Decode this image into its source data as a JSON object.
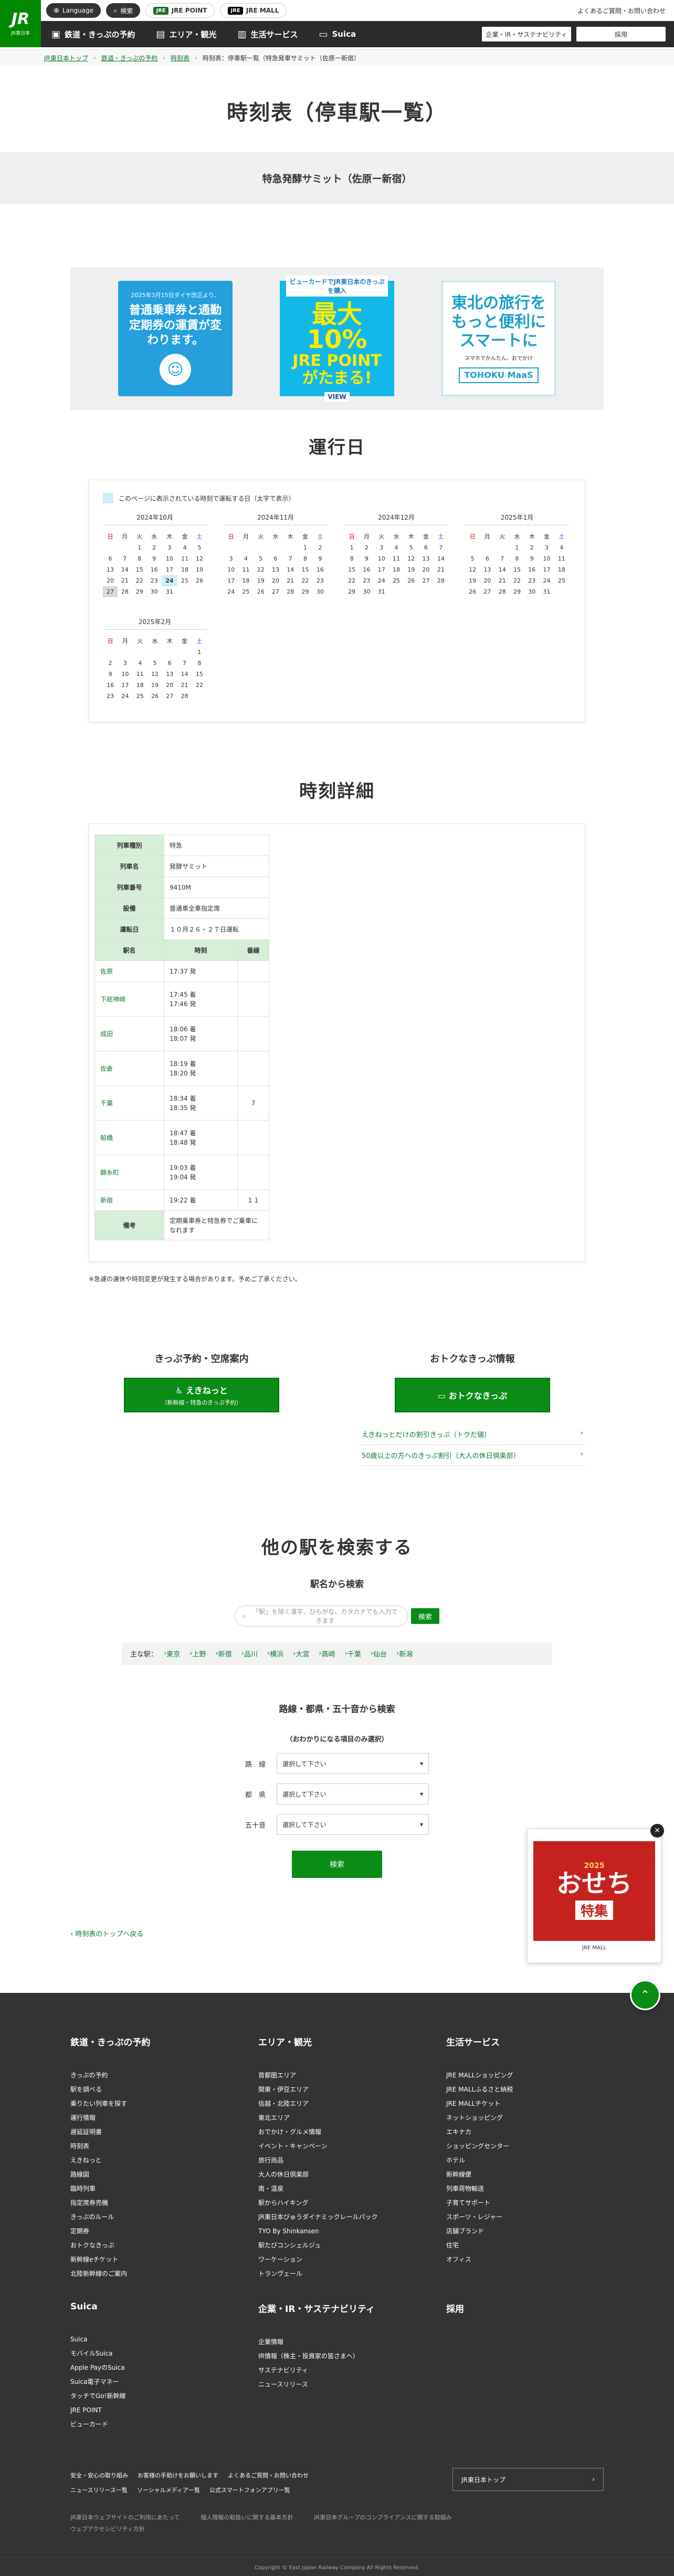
{
  "header": {
    "logo_text": "JR",
    "logo_sub": "JR東日本",
    "language": "Language",
    "search": "検索",
    "jrepoint": "JRE POINT",
    "jremall": "JRE MALL",
    "top_right": "よくあるご質問・お問い合わせ",
    "nav": [
      "鉄道・きっぷの予約",
      "エリア・観光",
      "生活サービス",
      "Suica"
    ],
    "btn_corp": "企業・IR・サステナビリティ",
    "btn_recruit": "採用"
  },
  "breadcrumb": [
    "JR東日本トップ",
    "鉄道・きっぷの予約",
    "時刻表",
    "時刻表：停車駅一覧（特急発車サミット（佐原ー新宿）"
  ],
  "page_title": "時刻表（停車駅一覧）",
  "train_name": "特急発酵サミット（佐原ー新宿）",
  "banners": {
    "b1_small": "2025年3月15日ダイヤ改正より、",
    "b1_main": "普通乗車券と通勤定期券の運賃が変わります。",
    "b2_top": "ビューカードでJR東日本のきっぷを購入",
    "b2_big": "最大10%",
    "b2_mid": "JRE POINTがたまる!",
    "b2_logo": "VIEW",
    "b3_main": "東北の旅行をもっと便利にスマートに",
    "b3_small": "スマホでかんたん、おでかけ",
    "b3_logo": "TOHOKU MaaS"
  },
  "section_calendar": "運行日",
  "calendar_legend": "このページに表示されている時刻で運転する日（太字で表示）",
  "weekdays": [
    "日",
    "月",
    "火",
    "水",
    "木",
    "金",
    "土"
  ],
  "months": [
    {
      "label": "2024年10月",
      "offset": 2,
      "days": 31,
      "highlight": [
        24
      ],
      "gray": [
        27
      ]
    },
    {
      "label": "2024年11月",
      "offset": 5,
      "days": 30,
      "highlight": [],
      "gray": []
    },
    {
      "label": "2024年12月",
      "offset": 0,
      "days": 31,
      "highlight": [],
      "gray": []
    },
    {
      "label": "2025年1月",
      "offset": 3,
      "days": 31,
      "highlight": [],
      "gray": []
    },
    {
      "label": "2025年2月",
      "offset": 6,
      "days": 28,
      "highlight": [],
      "gray": []
    }
  ],
  "section_detail": "時刻詳細",
  "info": [
    {
      "k": "列車種別",
      "v": "特急"
    },
    {
      "k": "列車名",
      "v": "発酵サミット"
    },
    {
      "k": "列車番号",
      "v": "9410M"
    },
    {
      "k": "設備",
      "v": "普通車全車指定席"
    },
    {
      "k": "運転日",
      "v": "１０月２６・２７日運転"
    }
  ],
  "stop_headers": [
    "駅名",
    "時刻",
    "番線"
  ],
  "stops": [
    {
      "name": "佐原",
      "time": "17:37 発",
      "track": ""
    },
    {
      "name": "下総神崎",
      "time": "17:45 着\n17:46 発",
      "track": ""
    },
    {
      "name": "成田",
      "time": "18:06 着\n18:07 発",
      "track": ""
    },
    {
      "name": "佐倉",
      "time": "18:19 着\n18:20 発",
      "track": ""
    },
    {
      "name": "千葉",
      "time": "18:34 着\n18:35 発",
      "track": "7"
    },
    {
      "name": "船橋",
      "time": "18:47 着\n18:48 発",
      "track": ""
    },
    {
      "name": "錦糸町",
      "time": "19:03 着\n19:04 発",
      "track": ""
    },
    {
      "name": "新宿",
      "time": "19:22 着",
      "track": "１１"
    }
  ],
  "remarks_label": "備考",
  "remarks": "定期乗車券と特急券でご乗車になれます",
  "notice": "※急遽の運休や時刻変更が発生する場合があります。予めご了承ください。",
  "reserve": {
    "title": "きっぷ予約・空席案内",
    "btn": "えきねっと",
    "btn_sub": "（新幹線・特急のきっぷ予約）"
  },
  "deals": {
    "title": "おトクなきっぷ情報",
    "btn": "おトクなきっぷ",
    "links": [
      "えきねっとだけの割引きっぷ（トクだ値）",
      "50歳以上の方へのきっぷ割引（大人の休日倶楽部）"
    ]
  },
  "search": {
    "title": "他の駅を検索する",
    "by_name": "駅名から検索",
    "placeholder": "「駅」を除く漢字、ひらがな、カタカナでも入力できます",
    "btn": "検索",
    "main_label": "主な駅：",
    "main_stations": [
      "東京",
      "上野",
      "新宿",
      "品川",
      "横浜",
      "大宮",
      "高崎",
      "千葉",
      "仙台",
      "新潟"
    ],
    "by_route": "路線・都県・五十音から検索",
    "hint": "（おわかりになる項目のみ選択）",
    "rows": [
      {
        "label": "路　線",
        "value": "選択して下さい"
      },
      {
        "label": "都　県",
        "value": "選択して下さい"
      },
      {
        "label": "五十音",
        "value": "選択して下さい"
      }
    ],
    "submit": "検索"
  },
  "back_top": "時刻表のトップへ戻る",
  "float_ad": {
    "year": "2025",
    "title": "おせち",
    "sub": "特集",
    "caption": "JRE MALL"
  },
  "footer": {
    "col1_title": "鉄道・きっぷの予約",
    "col1": [
      "きっぷの予約",
      "駅を調べる",
      "乗りたい列車を探す",
      "運行情報",
      "遅延証明書",
      "時刻表",
      "えきねっと",
      "路線図",
      "臨時列車",
      "指定席券売機",
      "きっぷのルール",
      "定期券",
      "おトクなきっぷ",
      "新幹線eチケット",
      "北陸新幹線のご案内"
    ],
    "col2_title": "エリア・観光",
    "col2": [
      "首都圏エリア",
      "関東・伊豆エリア",
      "信越・北陸エリア",
      "東北エリア",
      "おでかけ・グルメ情報",
      "イベント・キャンペーン",
      "旅行商品",
      "大人の休日倶楽部",
      "南・温泉",
      "駅からハイキング",
      "JR東日本びゅうダイナミックレールパック",
      "TYO By Shinkansen",
      "駅たびコンシェルジュ",
      "ワーケーション",
      "トランヴェール"
    ],
    "col3_title": "生活サービス",
    "col3": [
      "JRE MALLショッピング",
      "JRE MALLふるさと納税",
      "JRE MALLチケット",
      "ネットショッピング",
      "エキナカ",
      "ショッピングセンター",
      "ホテル",
      "新幹線便",
      "列車荷物輸送",
      "子育てサポート",
      "スポーツ・レジャー",
      "店舗ブランド",
      "住宅",
      "オフィス"
    ],
    "col4_title": "Suica",
    "col4": [
      "Suica",
      "モバイルSuica",
      "Apple PayのSuica",
      "Suica電子マネー",
      "タッチでGo!新幹線",
      "JRE POINT",
      "ビューカード"
    ],
    "col5_title": "企業・IR・サステナビリティ",
    "col5": [
      "企業情報",
      "IR情報（株主・投資家の皆さまへ）",
      "サステナビリティ",
      "ニュースリリース"
    ],
    "col6_title": "採用",
    "bottom_links": [
      "安全・安心の取り組み",
      "お客様の手助けをお願いします",
      "よくあるご質問・お問い合わせ",
      "ニュースリリース一覧",
      "ソーシャルメディア一覧",
      "公式スマートフォンアプリ一覧"
    ],
    "jr_top": "JR東日本トップ",
    "small_links": [
      "JR東日本ウェブサイトのご利用にあたって",
      "個人情報の取扱いに関する基本方針",
      "JR東日本グループのコンプライアンスに関する取組み",
      "ウェブアクセシビリティ方針"
    ],
    "copyright": "Copyright © East Japan Railway Company All Rights Reserved."
  }
}
